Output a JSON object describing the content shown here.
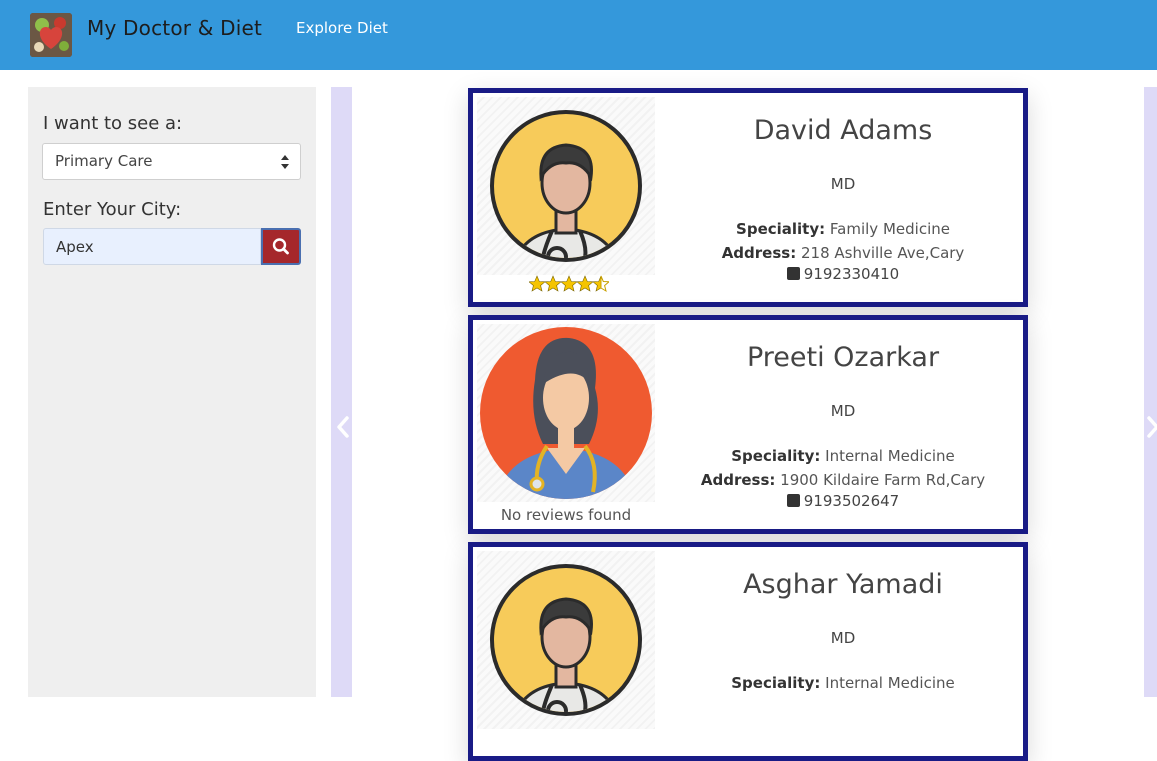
{
  "navbar": {
    "brand_title": "My Doctor & Diet",
    "links": [
      "Explore Diet"
    ],
    "bg_color": "#3498db"
  },
  "sidebar": {
    "specialty_label": "I want to see a:",
    "specialty_selected": "Primary Care",
    "city_label": "Enter Your City:",
    "city_value": "Apex",
    "search_icon": "search-icon"
  },
  "doctors": [
    {
      "name": "David Adams",
      "degree": "MD",
      "speciality_label": "Speciality:",
      "speciality": "Family Medicine",
      "address_label": "Address:",
      "address": "218 Ashville Ave,Cary",
      "phone": "9192330410",
      "rating": 4.5,
      "review_text": "",
      "avatar": "male-doctor-avatar-yellow"
    },
    {
      "name": "Preeti Ozarkar",
      "degree": "MD",
      "speciality_label": "Speciality:",
      "speciality": "Internal Medicine",
      "address_label": "Address:",
      "address": "1900 Kildaire Farm Rd,Cary",
      "phone": "9193502647",
      "rating": null,
      "review_text": "No reviews found",
      "avatar": "female-doctor-avatar-orange"
    },
    {
      "name": "Asghar Yamadi",
      "degree": "MD",
      "speciality_label": "Speciality:",
      "speciality": "Internal Medicine",
      "avatar": "male-doctor-avatar-yellow"
    }
  ],
  "colors": {
    "card_border": "#191b86",
    "search_button": "#a5272b",
    "star": "#f5c400",
    "carousel_side": "#dedaf7"
  }
}
